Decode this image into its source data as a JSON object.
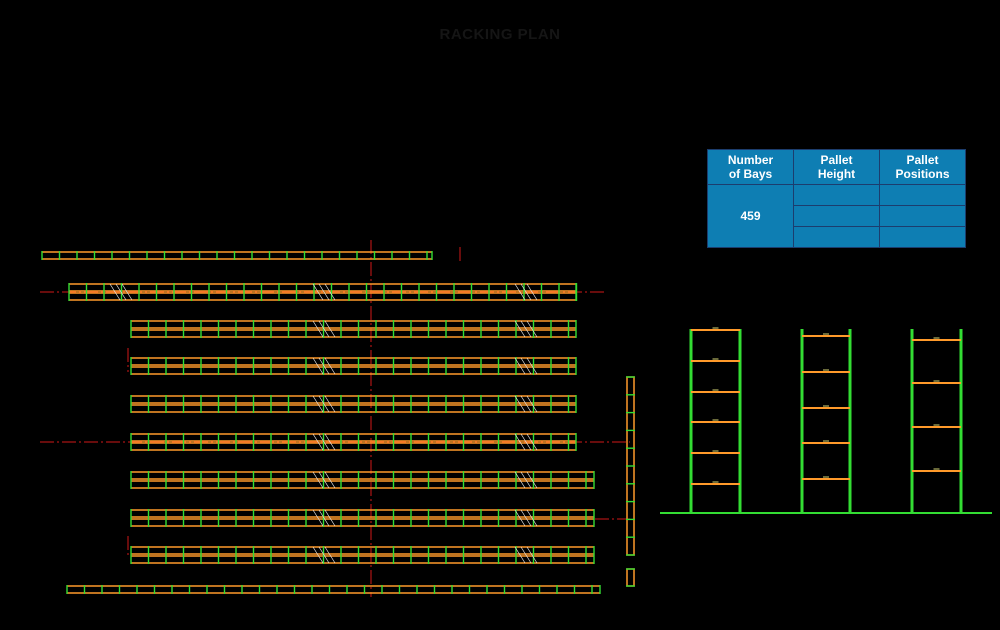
{
  "title": "RACKING PLAN",
  "table": {
    "headers": [
      "Number\nof Bays",
      "Pallet\nHeight",
      "Pallet\nPositions"
    ],
    "number_of_bays": "459",
    "pallet_height": [
      "",
      "",
      ""
    ],
    "pallet_positions": [
      "",
      "",
      ""
    ],
    "fill_color": "#0e7eb3",
    "border_color": "#1c3d6e"
  },
  "colors": {
    "background": "#000000",
    "frame": "#33dd33",
    "beam": "#ff9a2a",
    "center_line": "#d01818",
    "bracing": "#e8e8e8",
    "title": "#151515"
  },
  "elevation_views": [
    {
      "beam_levels": 6
    },
    {
      "beam_levels": 5
    },
    {
      "beam_levels": 4
    }
  ]
}
